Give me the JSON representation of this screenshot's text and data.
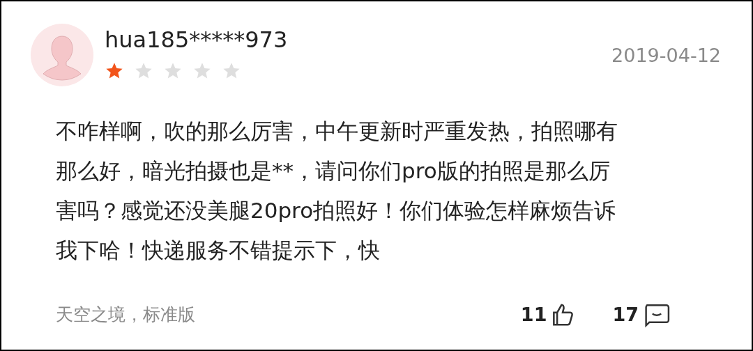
{
  "review": {
    "username": "hua185*****973",
    "stars": 1,
    "date": "2019-04-12",
    "text": "不咋样啊，吹的那么厉害，中午更新时严重发热，拍照哪有那么好，暗光拍摄也是**，请问你们pro版的拍照是那么厉害吗？感觉还没美腿20pro拍照好！你们体验怎样麻烦告诉我下哈！快递服务不错提示下，快",
    "variant": "天空之境，标准版",
    "likes": "11",
    "comments": "17"
  }
}
